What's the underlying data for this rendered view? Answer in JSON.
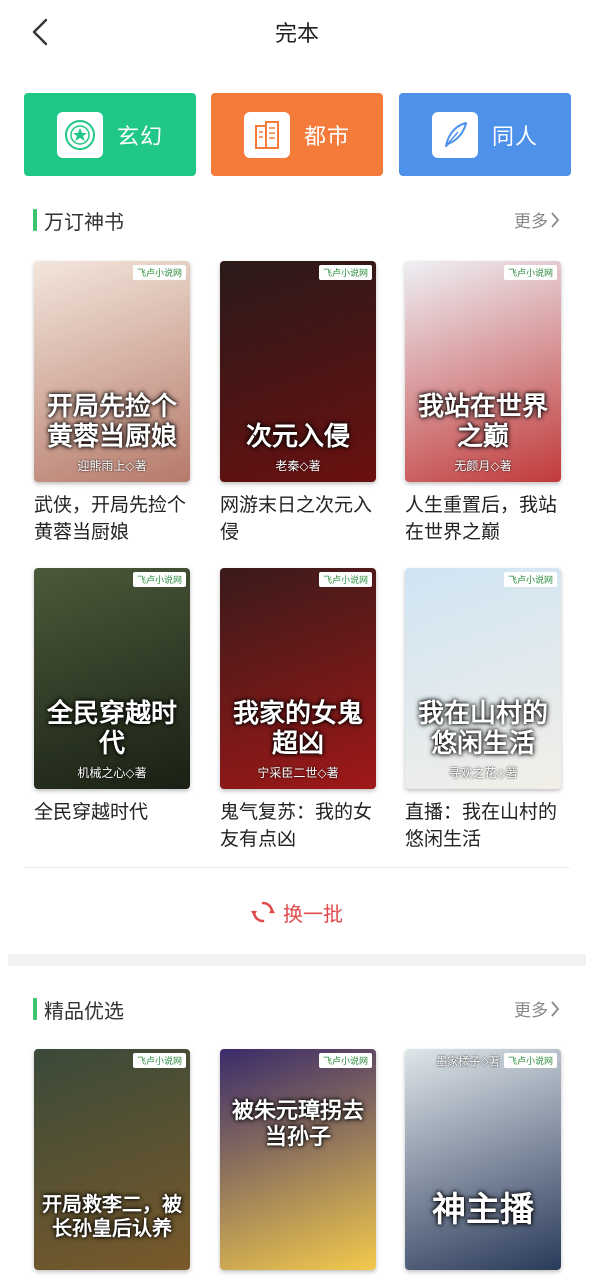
{
  "header": {
    "title": "完本"
  },
  "categories": [
    {
      "label": "玄幻",
      "color": "#21c786",
      "icon": "emblem-icon"
    },
    {
      "label": "都市",
      "color": "#f57b3b",
      "icon": "building-icon"
    },
    {
      "label": "同人",
      "color": "#4d91eb",
      "icon": "feather-icon"
    }
  ],
  "sections": [
    {
      "title": "万订神书",
      "more": "更多",
      "books": [
        {
          "name": "武侠，开局先捡个黄蓉当厨娘",
          "cover_title": "开局先捡个黄蓉当厨娘",
          "cover_author": "迎熊雨上◇著",
          "cover_colors": [
            "#f3e6dc",
            "#b67a6a"
          ]
        },
        {
          "name": "网游末日之次元入侵",
          "cover_title": "次元入侵",
          "cover_author": "老秦◇著",
          "cover_colors": [
            "#2a1a1a",
            "#6b1010"
          ]
        },
        {
          "name": "人生重置后，我站在世界之巅",
          "cover_title": "我站在世界之巅",
          "cover_author": "无颜月◇著",
          "cover_colors": [
            "#eef0f5",
            "#c13a3a"
          ]
        },
        {
          "name": "全民穿越时代",
          "cover_title": "全民穿越时代",
          "cover_author": "机械之心◇著",
          "cover_colors": [
            "#4a5a3a",
            "#1a2014"
          ]
        },
        {
          "name": "鬼气复苏：我的女友有点凶",
          "cover_title": "我家的女鬼超凶",
          "cover_author": "宁采臣二世◇著",
          "cover_colors": [
            "#3a1a1a",
            "#a01818"
          ]
        },
        {
          "name": "直播：我在山村的悠闲生活",
          "cover_title": "我在山村的悠闲生活",
          "cover_author": "寻欢之花◇著",
          "cover_colors": [
            "#cfe4f3",
            "#f2efe8"
          ]
        }
      ]
    },
    {
      "title": "精品优选",
      "more": "更多",
      "books": [
        {
          "name": "",
          "cover_title": "开局救李二，被长孙皇后认养",
          "cover_author": "",
          "cover_colors": [
            "#3a4a3a",
            "#7a5a2a"
          ]
        },
        {
          "name": "",
          "cover_title": "被朱元璋拐去当孙子",
          "cover_author": "",
          "cover_colors": [
            "#3a2a6a",
            "#f2c94c"
          ]
        },
        {
          "name": "",
          "cover_title": "神主播",
          "cover_author": "墨家橘子◇著",
          "cover_colors": [
            "#dfe6ea",
            "#2a3a5a"
          ]
        }
      ]
    }
  ],
  "refresh": {
    "label": "换一批"
  }
}
